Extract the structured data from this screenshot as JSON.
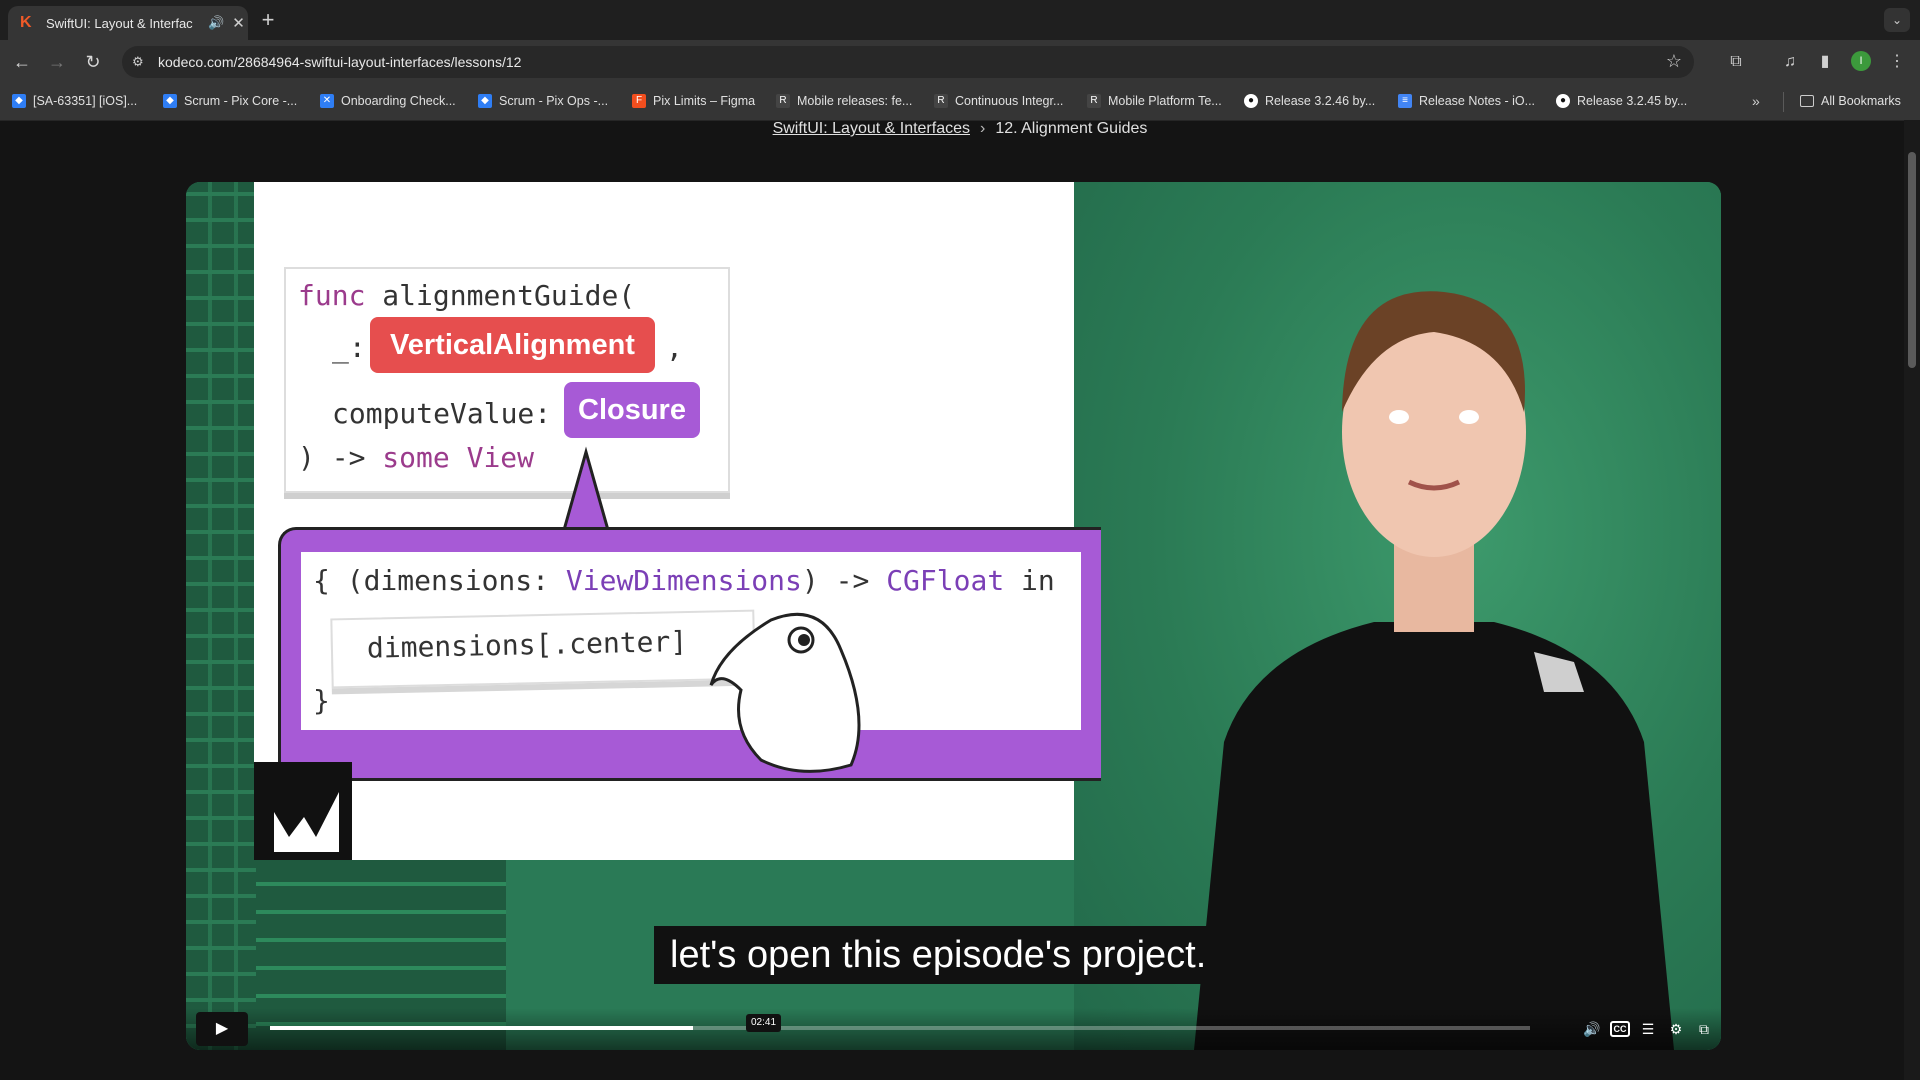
{
  "browser": {
    "tab": {
      "title": "SwiftUI: Layout & Interfac",
      "favicon": "K",
      "speaker": "🔊",
      "close": "✕"
    },
    "new_tab": "+",
    "url": "kodeco.com/28684964-swiftui-layout-interfaces/lessons/12",
    "profile_initial": "I"
  },
  "bookmarks": [
    {
      "label": "[SA-63351] [iOS]...",
      "icon": "jira-icon",
      "color": "#2f7ef5"
    },
    {
      "label": "Scrum - Pix Core -...",
      "icon": "jira-icon",
      "color": "#2f7ef5"
    },
    {
      "label": "Onboarding Check...",
      "icon": "confluence-icon",
      "color": "#2f7ef5"
    },
    {
      "label": "Scrum - Pix Ops -...",
      "icon": "jira-icon",
      "color": "#2f7ef5"
    },
    {
      "label": "Pix Limits – Figma",
      "icon": "figma-icon",
      "color": "#f24e1e"
    },
    {
      "label": "Mobile releases: fe...",
      "icon": "rmt-icon",
      "color": "#444444"
    },
    {
      "label": "Continuous Integr...",
      "icon": "rmt-icon",
      "color": "#444444"
    },
    {
      "label": "Mobile Platform Te...",
      "icon": "rmt-icon",
      "color": "#444444"
    },
    {
      "label": "Release 3.2.46 by...",
      "icon": "github-icon",
      "color": "#ffffff"
    },
    {
      "label": "Release Notes - iO...",
      "icon": "docs-icon",
      "color": "#4285f4"
    },
    {
      "label": "Release 3.2.45 by...",
      "icon": "github-icon",
      "color": "#ffffff"
    }
  ],
  "bookmarks_more": "»",
  "all_bookmarks": "All Bookmarks",
  "breadcrumb": {
    "course": "SwiftUI: Layout & Interfaces",
    "lesson": "12. Alignment Guides"
  },
  "slide": {
    "line1_kw": "func",
    "line1_rest": " alignmentGuide(",
    "line2_prefix": "_:",
    "param1": "VerticalAlignment",
    "line2_suffix": ",",
    "line3_prefix": "computeValue:",
    "param2": "Closure",
    "line4_prefix": ") -> ",
    "line4_kw": "some View",
    "closure_open": "{ (dimensions: ",
    "closure_type1": "ViewDimensions",
    "closure_mid": ") -> ",
    "closure_type2": "CGFloat",
    "closure_end": " in",
    "closure_body": "dimensions[.center]",
    "closure_close": "}"
  },
  "video": {
    "subtitle": "let's open this episode's project.",
    "time": "02:41",
    "progress_fraction": 0.336
  }
}
